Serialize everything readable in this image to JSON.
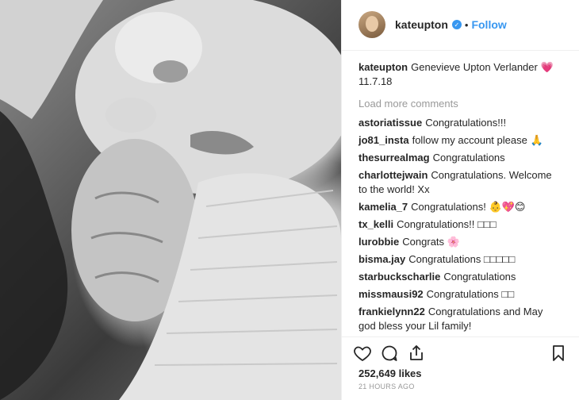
{
  "post": {
    "username": "kateupton",
    "follow_label": "Follow",
    "separator": "•",
    "caption": {
      "username": "kateupton",
      "text": "Genevieve Upton Verlander 💗 11.7.18"
    },
    "load_more_label": "Load more comments",
    "comments": [
      {
        "user": "astoriatissue",
        "text": "Congratulations!!!"
      },
      {
        "user": "jo81_insta",
        "text": "follow my account please 🙏"
      },
      {
        "user": "thesurrealmag",
        "text": "Congratulations"
      },
      {
        "user": "charlottejwain",
        "text": "Congratulations. Welcome to the world! Xx"
      },
      {
        "user": "kamelia_7",
        "text": "Congratulations! 👶💖😊"
      },
      {
        "user": "tx_kelli",
        "text": "Congratulations!! □□□"
      },
      {
        "user": "lurobbie",
        "text": "Congrats 🌸"
      },
      {
        "user": "bisma.jay",
        "text": "Congratulations □□□□□"
      },
      {
        "user": "starbuckscharlie",
        "text": "Congratulations"
      },
      {
        "user": "missmausi92",
        "text": "Congratulations □□"
      },
      {
        "user": "frankielynn22",
        "text": "Congratulations and May god bless your Lil family!"
      }
    ],
    "likes": "252,649 likes",
    "time_ago": "21 HOURS AGO"
  },
  "icons": {
    "verified": "verified-badge-icon",
    "like": "heart-icon",
    "comment": "comment-bubble-icon",
    "share": "share-icon",
    "save": "bookmark-icon"
  },
  "colors": {
    "link_blue": "#3897f0",
    "muted": "#999999",
    "text": "#262626"
  }
}
